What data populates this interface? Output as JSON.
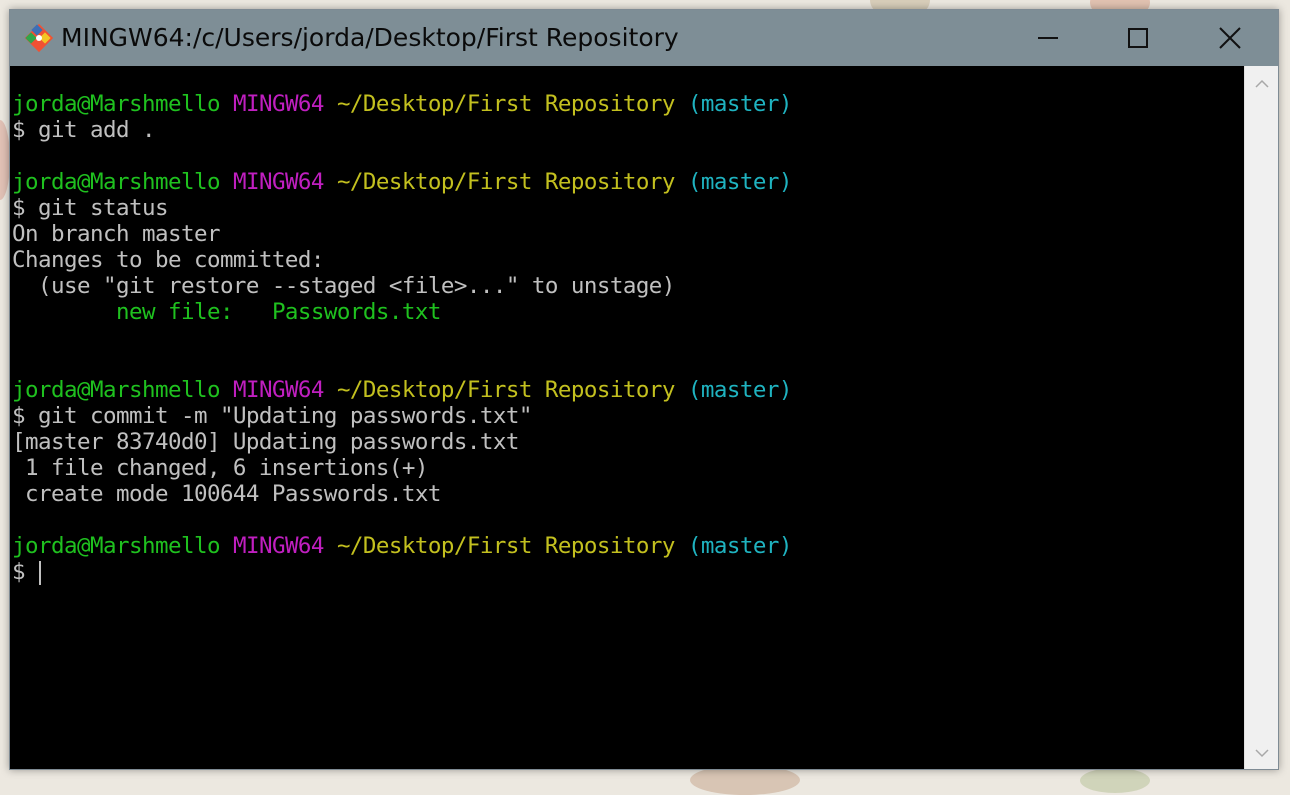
{
  "window": {
    "title": "MINGW64:/c/Users/jorda/Desktop/First Repository",
    "icon": "git-icon",
    "controls": {
      "minimize": "minimize-icon",
      "maximize": "maximize-icon",
      "close": "close-icon"
    }
  },
  "colors": {
    "titlebar": "#7e8e96",
    "prompt_user": "#1fc11f",
    "prompt_shell": "#c01fc0",
    "prompt_path": "#c3c01f",
    "prompt_branch": "#1fb3c0",
    "text": "#c0c0c0",
    "background": "#000000"
  },
  "prompt": {
    "user": "jorda@Marshmello",
    "shell": "MINGW64",
    "path": "~/Desktop/First Repository",
    "branch": "(master)",
    "symbol": "$"
  },
  "terminal": {
    "cmd1": "git add .",
    "cmd2": "git status",
    "status_line1": "On branch master",
    "status_line2": "Changes to be committed:",
    "status_line3": "  (use \"git restore --staged <file>...\" to unstage)",
    "status_newfile_label": "        new file:   ",
    "status_newfile_name": "Passwords.txt",
    "cmd3": "git commit -m \"Updating passwords.txt\"",
    "commit_line1": "[master 83740d0] Updating passwords.txt",
    "commit_line2": " 1 file changed, 6 insertions(+)",
    "commit_line3": " create mode 100644 Passwords.txt"
  }
}
